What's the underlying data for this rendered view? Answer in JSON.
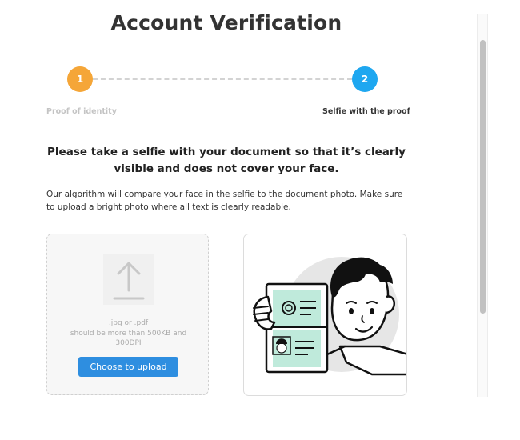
{
  "page": {
    "title": "Account Verification"
  },
  "steps": [
    {
      "number": "1",
      "label": "Proof of identity",
      "color": "#f5a638"
    },
    {
      "number": "2",
      "label": "Selfie with the proof",
      "color": "#1ea7f0"
    }
  ],
  "instruction": "Please take a selfie with your document so that it’s clearly visible and does not cover your face.",
  "description": "Our algorithm will compare your face in the selfie to the document photo. Make sure to upload a bright photo where all text is clearly readable.",
  "upload": {
    "hint_lines": [
      ".jpg or .pdf",
      "should be more than 500KB and",
      "300DPI"
    ],
    "button_label": "Choose to upload",
    "button_color": "#2e8ee0",
    "icon": "upload-arrow-icon"
  },
  "illustration": {
    "icon": "selfie-with-document-illustration",
    "accent": "#bfeadb"
  }
}
